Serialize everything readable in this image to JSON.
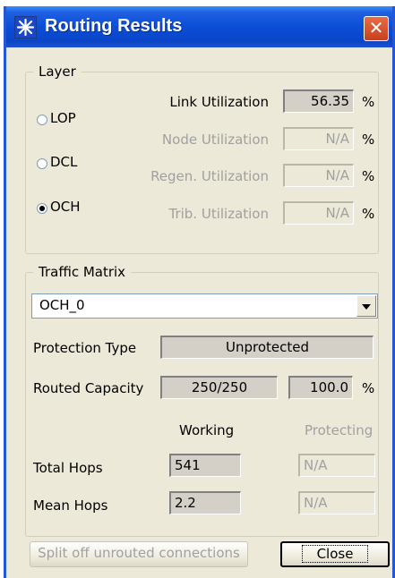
{
  "window": {
    "title": "Routing Results",
    "close_glyph": "✕"
  },
  "layer": {
    "legend": "Layer",
    "options": [
      {
        "label": "LOP",
        "selected": false
      },
      {
        "label": "DCL",
        "selected": false
      },
      {
        "label": "OCH",
        "selected": true
      }
    ],
    "link_utilization": {
      "label": "Link Utilization",
      "value": "56.35",
      "unit": "%"
    },
    "node_utilization": {
      "label": "Node Utilization",
      "value": "N/A",
      "unit": "%"
    },
    "regen_utilization": {
      "label": "Regen. Utilization",
      "value": "N/A",
      "unit": "%"
    },
    "trib_utilization": {
      "label": "Trib. Utilization",
      "value": "N/A",
      "unit": "%"
    }
  },
  "traffic": {
    "legend": "Traffic Matrix",
    "selected_matrix": "OCH_0",
    "protection_type": {
      "label": "Protection Type",
      "value": "Unprotected"
    },
    "routed_capacity": {
      "label": "Routed Capacity",
      "value": "250/250",
      "percent": "100.0",
      "unit": "%"
    },
    "working_header": "Working",
    "protecting_header": "Protecting",
    "total_hops": {
      "label": "Total Hops",
      "working": "541",
      "protecting": "N/A"
    },
    "mean_hops": {
      "label": "Mean Hops",
      "working": "2.2",
      "protecting": "N/A"
    }
  },
  "buttons": {
    "split_label": "Split off unrouted connections",
    "close_label": "Close"
  },
  "colors": {
    "title_bar": "#0a4ed8",
    "dialog_bg": "#ece9d8",
    "close_button": "#d9532b"
  }
}
